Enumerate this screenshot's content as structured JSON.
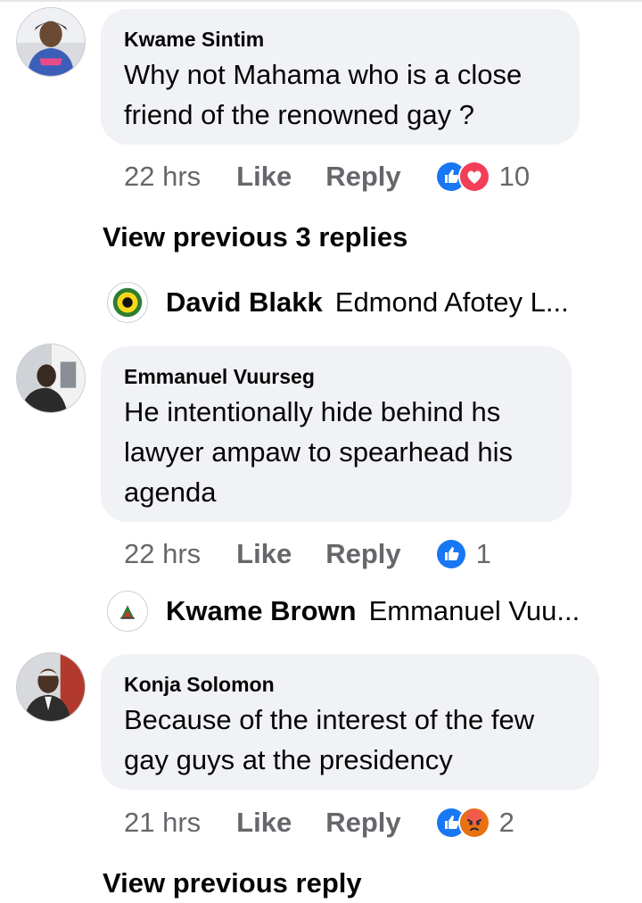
{
  "comments": [
    {
      "author": "Kwame Sintim",
      "lines": [
        "Why not Mahama who is a close",
        "friend of the renowned gay ?"
      ],
      "time": "22 hrs",
      "like": "Like",
      "reply": "Reply",
      "reactions": [
        "like-icon",
        "love-icon"
      ],
      "reaction_count": "10"
    },
    {
      "author": "Emmanuel Vuurseg",
      "lines": [
        "He intentionally hide behind hs",
        "lawyer ampaw to spearhead his",
        "agenda"
      ],
      "time": "22 hrs",
      "like": "Like",
      "reply": "Reply",
      "reactions": [
        "like-icon"
      ],
      "reaction_count": "1"
    },
    {
      "author": "Konja Solomon",
      "lines": [
        "Because of the interest of the few",
        "gay guys at the presidency"
      ],
      "time": "21 hrs",
      "like": "Like",
      "reply": "Reply",
      "reactions": [
        "like-icon",
        "angry-icon"
      ],
      "reaction_count": "2"
    }
  ],
  "view_previous_1": "View previous 3 replies",
  "reply_preview_1": {
    "name": "David Blakk",
    "text": "Edmond Afotey L..."
  },
  "reply_preview_2": {
    "name": "Kwame Brown",
    "text": "Emmanuel Vuu..."
  },
  "view_previous_2": "View previous reply",
  "colors": {
    "bubble": "#f0f2f5",
    "like_blue": "#1877f2",
    "love_red": "#f33e58",
    "angry_orange": "#e9710f",
    "meta_gray": "#65676b"
  }
}
